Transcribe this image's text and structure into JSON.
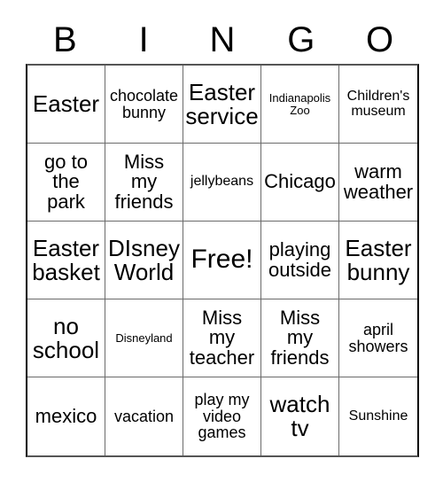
{
  "card": {
    "header_letters": [
      "B",
      "I",
      "N",
      "G",
      "O"
    ],
    "rows": [
      [
        {
          "text": "Easter",
          "size": "fs-lg"
        },
        {
          "text": "chocolate\nbunny",
          "size": "fs-sm"
        },
        {
          "text": "Easter\nservice",
          "size": "fs-lg"
        },
        {
          "text": "Indianapolis\nZoo",
          "size": "fs-xxs"
        },
        {
          "text": "Children's\nmuseum",
          "size": "fs-xs"
        }
      ],
      [
        {
          "text": "go to\nthe\npark",
          "size": "fs-md"
        },
        {
          "text": "Miss\nmy\nfriends",
          "size": "fs-md"
        },
        {
          "text": "jellybeans",
          "size": "fs-xs"
        },
        {
          "text": "Chicago",
          "size": "fs-md"
        },
        {
          "text": "warm\nweather",
          "size": "fs-md"
        }
      ],
      [
        {
          "text": "Easter\nbasket",
          "size": "fs-lg"
        },
        {
          "text": "DIsney\nWorld",
          "size": "fs-lg"
        },
        {
          "text": "Free!",
          "size": "fs-xl"
        },
        {
          "text": "playing\noutside",
          "size": "fs-md"
        },
        {
          "text": "Easter\nbunny",
          "size": "fs-lg"
        }
      ],
      [
        {
          "text": "no\nschool",
          "size": "fs-lg"
        },
        {
          "text": "Disneyland",
          "size": "fs-xxs"
        },
        {
          "text": "Miss\nmy\nteacher",
          "size": "fs-md"
        },
        {
          "text": "Miss\nmy\nfriends",
          "size": "fs-md"
        },
        {
          "text": "april\nshowers",
          "size": "fs-sm"
        }
      ],
      [
        {
          "text": "mexico",
          "size": "fs-md"
        },
        {
          "text": "vacation",
          "size": "fs-sm"
        },
        {
          "text": "play my\nvideo\ngames",
          "size": "fs-sm"
        },
        {
          "text": "watch\ntv",
          "size": "fs-lg"
        },
        {
          "text": "Sunshine",
          "size": "fs-xs"
        }
      ]
    ]
  }
}
